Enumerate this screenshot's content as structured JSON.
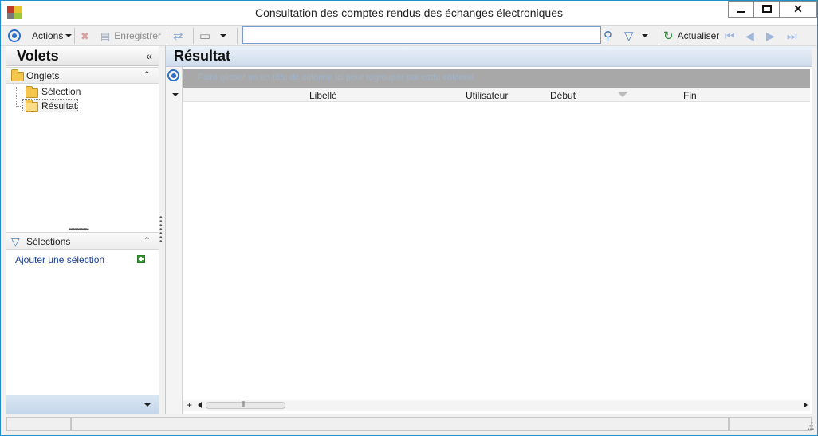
{
  "window": {
    "title": "Consultation des comptes rendus des échanges électroniques",
    "controls": {
      "minimize": "minimize",
      "maximize": "maximize",
      "close": "✕"
    }
  },
  "toolbar": {
    "actions_label": "Actions",
    "save_label": "Enregistrer",
    "refresh_label": "Actualiser",
    "search": {
      "value": "",
      "placeholder": ""
    }
  },
  "left_panel": {
    "title": "Volets",
    "collapse_glyph": "«",
    "tabs_section": {
      "title": "Onglets",
      "items": [
        {
          "label": "Sélection"
        },
        {
          "label": "Résultat"
        }
      ]
    },
    "selections_section": {
      "title": "Sélections",
      "add_label": "Ajouter une sélection"
    }
  },
  "result_panel": {
    "title": "Résultat",
    "group_hint": "Faire glisser un en-tête de colonne ici pour regrouper par cette colonne",
    "columns": [
      "Libellé",
      "Utilisateur",
      "Début",
      "Fin"
    ],
    "rows": []
  },
  "icons": {
    "toolbar": [
      "options-circle-icon",
      "delete-icon",
      "save-icon",
      "refresh-icon",
      "print-icon",
      "search-icon",
      "filter-icon",
      "refresh-green-icon",
      "first-page-icon",
      "prev-page-icon",
      "next-page-icon",
      "last-page-icon"
    ],
    "accent": "#2a6fc9",
    "header_gradient": "#cfdcec"
  }
}
